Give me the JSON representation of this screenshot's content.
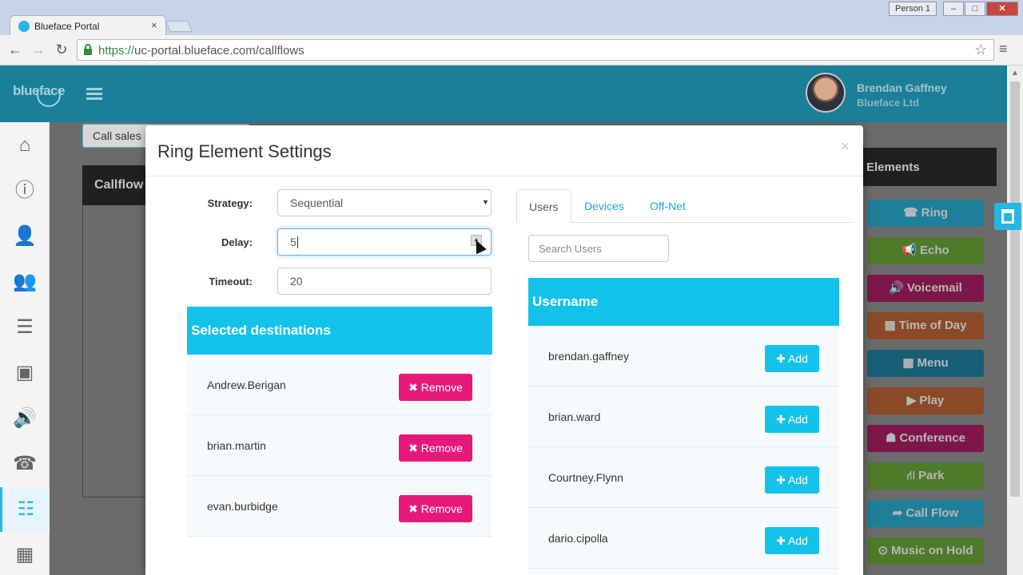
{
  "browser": {
    "tab_title": "Blueface Portal",
    "tab_close": "×",
    "profile": "Person 1",
    "url_scheme": "https://",
    "url_rest": "uc-portal.blueface.com/callflows",
    "back": "←",
    "forward": "→",
    "reload": "↻",
    "bookmark": "☆",
    "menu": "≡",
    "min": "‒",
    "max": "□",
    "close": "✕"
  },
  "app": {
    "logo": "blueface",
    "user_name": "Brendan Gaffney",
    "user_org": "Blueface Ltd"
  },
  "sidebar": {
    "icons": [
      "home-icon",
      "info-icon",
      "user-icon",
      "users-icon",
      "notepad-icon",
      "contacts-icon",
      "speaker-icon",
      "phone-icon",
      "sliders-icon",
      "grid-icon"
    ],
    "glyphs": [
      "⌂",
      "ⓘ",
      "👤",
      "👥",
      "☰",
      "▣",
      "🔊",
      "☎",
      "☷",
      "▦"
    ],
    "active_index": 8
  },
  "background": {
    "call_sales": "Call sales",
    "callflow": "Callflow",
    "elements": "Elements",
    "element_buttons": [
      {
        "label": "Ring",
        "icon": "phone-icon",
        "glyph": "☎",
        "color": "#1d7f98"
      },
      {
        "label": "Echo",
        "icon": "megaphone-icon",
        "glyph": "📢",
        "color": "#4e7a2a"
      },
      {
        "label": "Voicemail",
        "icon": "speaker-icon",
        "glyph": "🔊",
        "color": "#7d1649"
      },
      {
        "label": "Time of Day",
        "icon": "calendar-icon",
        "glyph": "▦",
        "color": "#8a4a27"
      },
      {
        "label": "Menu",
        "icon": "grid-icon",
        "glyph": "▦",
        "color": "#165e75"
      },
      {
        "label": "Play",
        "icon": "play-icon",
        "glyph": "▶",
        "color": "#8a4a27"
      },
      {
        "label": "Conference",
        "icon": "group-icon",
        "glyph": "☗",
        "color": "#7d1649"
      },
      {
        "label": "Park",
        "icon": "road-icon",
        "glyph": "⛙",
        "color": "#4e7a2a"
      },
      {
        "label": "Call Flow",
        "icon": "share-icon",
        "glyph": "➦",
        "color": "#1d7f98"
      },
      {
        "label": "Music on Hold",
        "icon": "play-circle-icon",
        "glyph": "⊙",
        "color": "#4e7a2a"
      }
    ]
  },
  "modal": {
    "title": "Ring Element Settings",
    "close": "×",
    "strategy_label": "Strategy:",
    "strategy_value": "Sequential",
    "delay_label": "Delay:",
    "delay_value": "5",
    "timeout_label": "Timeout:",
    "timeout_value": "20",
    "selected_heading": "Selected destinations",
    "remove_label": "✖ Remove",
    "selected": [
      "Andrew.Berigan",
      "brian.martin",
      "evan.burbidge"
    ],
    "tabs": [
      "Users",
      "Devices",
      "Off-Net"
    ],
    "search_placeholder": "Search Users",
    "username_heading": "Username",
    "add_label": "✚ Add",
    "users": [
      "brendan.gaffney",
      "brian.ward",
      "Courtney.Flynn",
      "dario.cipolla"
    ]
  }
}
